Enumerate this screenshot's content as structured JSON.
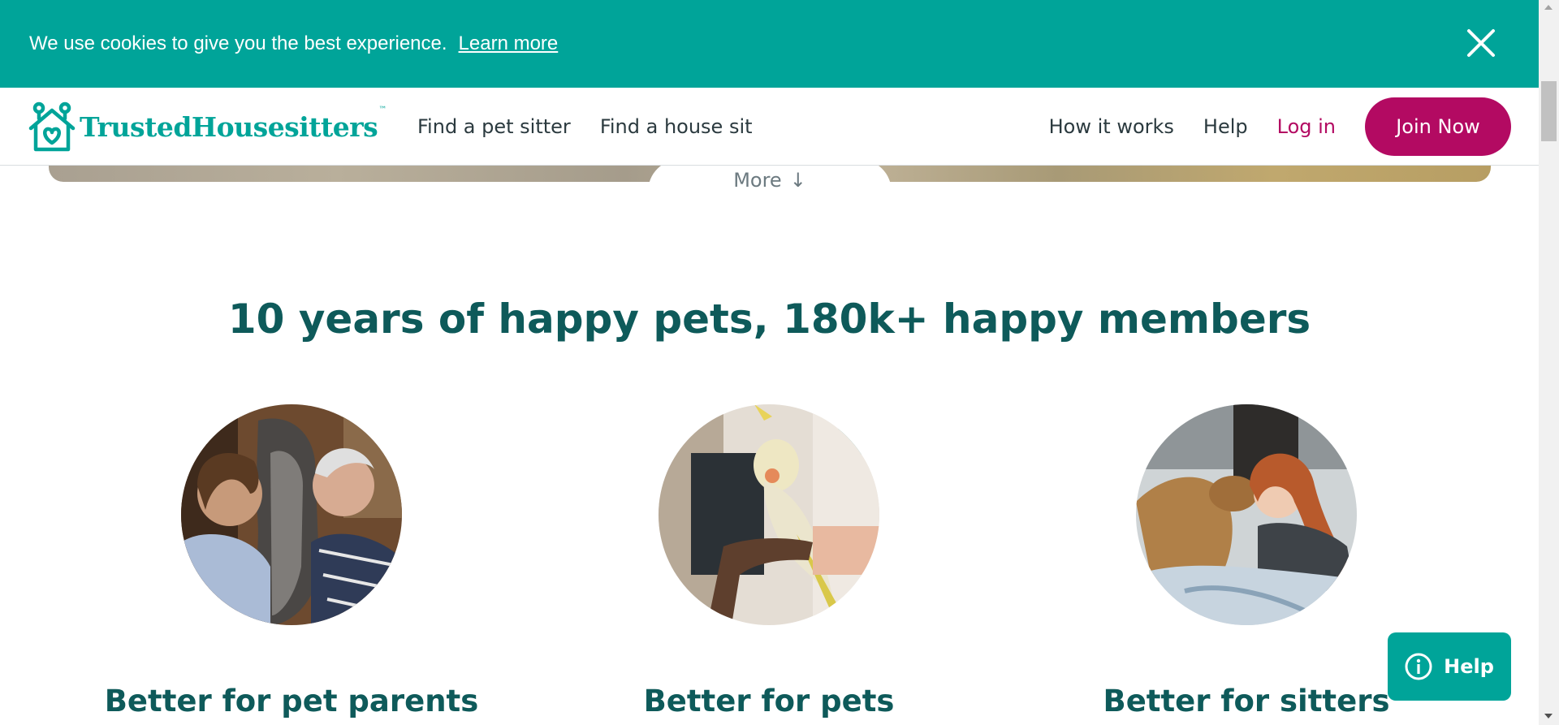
{
  "cookie_banner": {
    "message": "We use cookies to give you the best experience.",
    "learn_more": "Learn more",
    "close_icon": "close-icon"
  },
  "header": {
    "logo_text": "TrustedHousesitters",
    "logo_tm": "™",
    "nav_left": [
      "Find a pet sitter",
      "Find a house sit"
    ],
    "nav_right": [
      "How it works",
      "Help"
    ],
    "login": "Log in",
    "join": "Join Now"
  },
  "hero": {
    "more_label": "More",
    "more_icon": "arrow-down-icon"
  },
  "main": {
    "headline": "10 years of happy pets, 180k+ happy members",
    "features": [
      {
        "title": "Better for pet parents",
        "image": "couple-with-horse"
      },
      {
        "title": "Better for pets",
        "image": "cockatiel-on-hand"
      },
      {
        "title": "Better for sitters",
        "image": "woman-with-dog"
      }
    ]
  },
  "help_button": {
    "label": "Help",
    "icon": "info-icon"
  },
  "colors": {
    "teal": "#00a499",
    "dark_teal": "#0e5a5a",
    "magenta": "#b30a62"
  }
}
